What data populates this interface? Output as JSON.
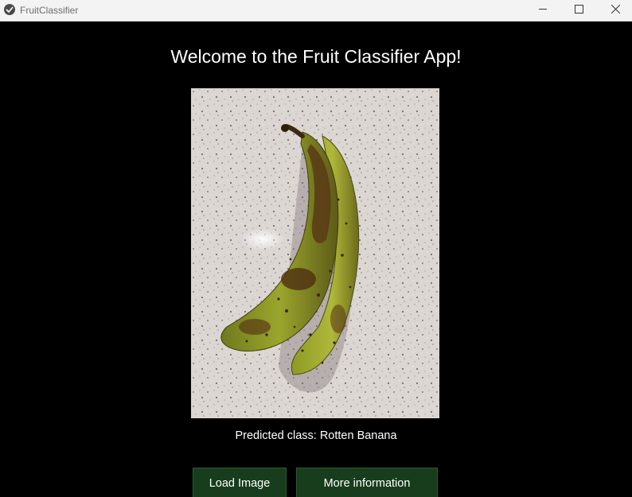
{
  "window": {
    "title": "FruitClassifier"
  },
  "main": {
    "heading": "Welcome to the Fruit Classifier App!",
    "image_alt": "banana-photo",
    "prediction_text": "Predicted class: Rotten Banana"
  },
  "buttons": {
    "load_image": "Load Image",
    "more_info": "More information"
  },
  "colors": {
    "background": "#000000",
    "button_bg": "#173d1c",
    "titlebar_bg": "#f3f3f3"
  },
  "icons": {
    "app": "app-logo-icon",
    "minimize": "minimize-icon",
    "maximize": "maximize-icon",
    "close": "close-icon"
  }
}
